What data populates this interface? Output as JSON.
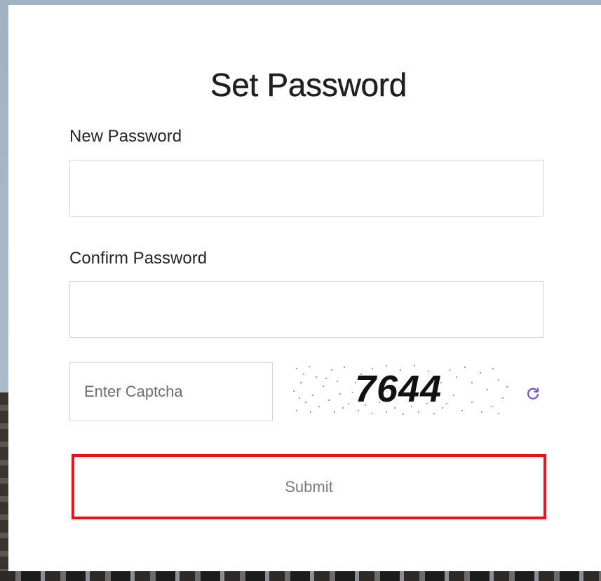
{
  "form": {
    "title": "Set Password",
    "new_password": {
      "label": "New Password",
      "value": "",
      "placeholder": ""
    },
    "confirm_password": {
      "label": "Confirm Password",
      "value": "",
      "placeholder": ""
    },
    "captcha": {
      "placeholder": "Enter Captcha",
      "value": "",
      "image_text": "7644",
      "refresh_icon": "refresh-icon"
    },
    "submit_label": "Submit"
  },
  "colors": {
    "submit_border": "#e8141b",
    "refresh_icon": "#6f56c9"
  }
}
